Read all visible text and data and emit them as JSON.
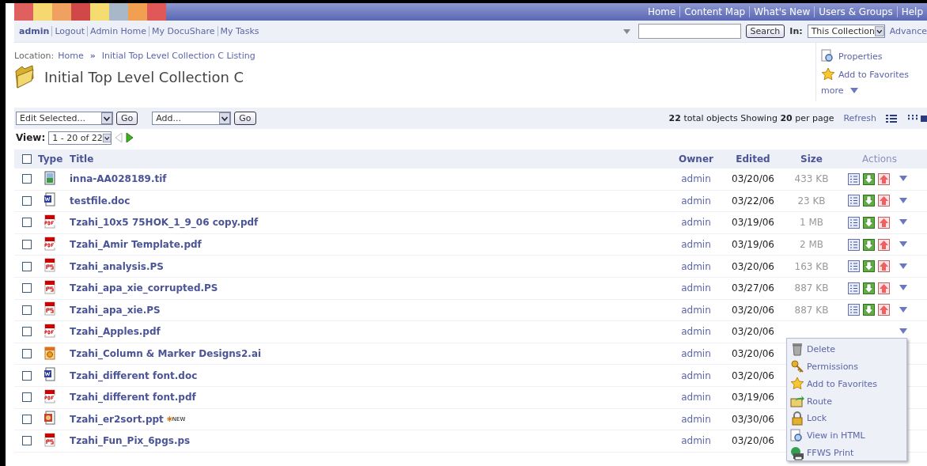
{
  "top_nav": [
    "Home",
    "Content Map",
    "What's New",
    "Users & Groups",
    "Help"
  ],
  "user_bar": {
    "user": "admin",
    "links": [
      "Logout",
      "Admin Home",
      "My DocuShare",
      "My Tasks"
    ]
  },
  "search": {
    "button": "Search",
    "in_label": "In:",
    "scope": "This Collection",
    "advanced": "Advance"
  },
  "location": {
    "label": "Location:",
    "path": [
      "Home",
      "Initial Top Level Collection C Listing"
    ],
    "separator": "»"
  },
  "title": "Initial Top Level Collection C",
  "side_actions": [
    {
      "label": "Properties",
      "kind": "properties"
    },
    {
      "label": "Add to Favorites",
      "kind": "favorite"
    }
  ],
  "more": "more",
  "toolbar": {
    "edit_select": "Edit Selected...",
    "go": "Go",
    "add_select": "Add...",
    "go_add": "Go"
  },
  "summary": "**22** total objects Showing **20** per page",
  "refresh": "Refresh",
  "view": {
    "label": "View:",
    "range": "1 - 20 of 22"
  },
  "table": {
    "checked": false,
    "columns": [
      "Type",
      "Title",
      "Owner",
      "Edited",
      "Size",
      "Actions"
    ],
    "rows": [
      {
        "kind": "tif",
        "title": "inna-AA028189.tif",
        "owner": "admin",
        "edited": "03/20/06",
        "size": "433 KB",
        "checked": false
      },
      {
        "kind": "doc",
        "title": "testfile.doc",
        "owner": "admin",
        "edited": "03/22/06",
        "size": "23 KB",
        "checked": false
      },
      {
        "kind": "pdf",
        "title": "Tzahi_10x5 75HOK_1_9_06 copy.pdf",
        "owner": "admin",
        "edited": "03/19/06",
        "size": "1 MB",
        "checked": false
      },
      {
        "kind": "pdf",
        "title": "Tzahi_Amir Template.pdf",
        "owner": "admin",
        "edited": "03/19/06",
        "size": "2 MB",
        "checked": false
      },
      {
        "kind": "ps",
        "title": "Tzahi_analysis.PS",
        "owner": "admin",
        "edited": "03/20/06",
        "size": "163 KB",
        "checked": false
      },
      {
        "kind": "ps",
        "title": "Tzahi_apa_xie_corrupted.PS",
        "owner": "admin",
        "edited": "03/27/06",
        "size": "887 KB",
        "checked": false
      },
      {
        "kind": "ps",
        "title": "Tzahi_apa_xie.PS",
        "owner": "admin",
        "edited": "03/20/06",
        "size": "887 KB",
        "checked": false
      },
      {
        "kind": "pdf",
        "title": "Tzahi_Apples.pdf",
        "owner": "admin",
        "edited": "03/20/06",
        "checked": false
      },
      {
        "kind": "ai",
        "title": "Tzahi_Column & Marker Designs2.ai",
        "owner": "admin",
        "edited": "03/20/06",
        "checked": false
      },
      {
        "kind": "doc",
        "title": "Tzahi_different font.doc",
        "owner": "admin",
        "edited": "03/20/06",
        "checked": false
      },
      {
        "kind": "pdf",
        "title": "Tzahi_different font.pdf",
        "owner": "admin",
        "edited": "03/19/06",
        "checked": false
      },
      {
        "kind": "ppt",
        "title": "Tzahi_er2sort.ppt",
        "badge": "NEW",
        "owner": "admin",
        "edited": "03/30/06",
        "checked": false
      },
      {
        "kind": "ps",
        "title": "Tzahi_Fun_Pix_6pgs.ps",
        "owner": "admin",
        "edited": "03/20/06",
        "checked": false
      }
    ]
  },
  "context_menu": [
    {
      "label": "Delete",
      "kind": "delete"
    },
    {
      "label": "Permissions",
      "kind": "key"
    },
    {
      "label": "Add to Favorites",
      "kind": "favorite"
    },
    {
      "label": "Route",
      "kind": "route"
    },
    {
      "label": "Lock",
      "kind": "lock"
    },
    {
      "label": "View in HTML",
      "kind": "html"
    },
    {
      "label": "FFWS Print",
      "kind": "print"
    }
  ]
}
